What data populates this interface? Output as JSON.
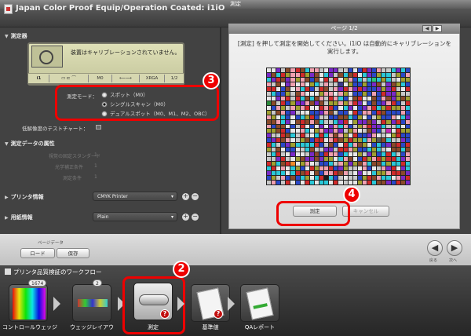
{
  "window": {
    "title": "測定"
  },
  "header": {
    "title": "Japan Color Proof Equip/Operation Coated: i1iO"
  },
  "left": {
    "instrument_section": "測定器",
    "device_message": "装置はキャリブレーションされていません。",
    "device_strip": [
      "i1",
      "",
      "M0",
      "",
      "XRGA",
      "1/2"
    ],
    "mode_label": "測定モード：",
    "modes": [
      "スポット（M0）",
      "シングルスキャン（M0）",
      "デュアルスポット（M0、M1、M2、OBC）"
    ],
    "selected_mode_index": 1,
    "lowdensity_label": "低解像度のテストチャート：",
    "attr_section": "測定データの属性",
    "attr_rows": [
      {
        "label": "視覚の固定スタンダード",
        "value": "1"
      },
      {
        "label": "光学補正条件",
        "value": "1"
      },
      {
        "label": "測定条件",
        "value": "1"
      }
    ],
    "printer_label": "プリンタ情報",
    "printer_value": "CMYK Printer",
    "paper_label": "用紙情報",
    "paper_value": "Plain"
  },
  "right": {
    "page_label": "ページ 1/2",
    "instruction": "[測定] を押して測定を開始してください。i1iO は自動的にキャリブレーションを実行します。",
    "measure_button": "測定",
    "cancel_button": "キャンセル"
  },
  "toolbar": {
    "page_data_label": "ページデータ",
    "load_button": "ロード",
    "save_button": "保存",
    "back_label": "戻る",
    "next_label": "次へ"
  },
  "workflow": {
    "title": "プリンタ品質検証のワークフロー",
    "steps": [
      {
        "label": "コントロールウェッジ",
        "count": "1674"
      },
      {
        "label": "ウェッジレイアウ",
        "count": "2"
      },
      {
        "label": "測定",
        "count": ""
      },
      {
        "label": "基準値",
        "count": ""
      },
      {
        "label": "QAレポート",
        "count": ""
      }
    ]
  },
  "annotations": {
    "badge_2": "2",
    "badge_3": "3",
    "badge_4": "4"
  },
  "colors": {
    "annotation_red": "#e00000",
    "panel_bg": "#424242",
    "toolbar_bg": "#d0d0d0"
  }
}
